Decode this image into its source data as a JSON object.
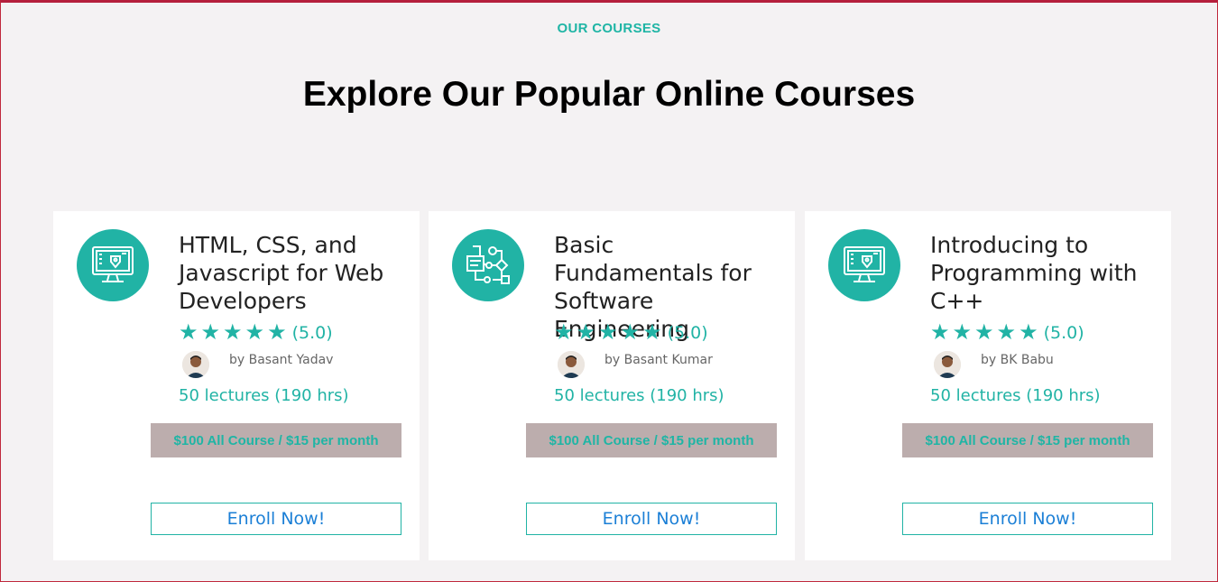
{
  "section": {
    "eyebrow": "OUR COURSES",
    "headline": "Explore Our Popular Online Courses"
  },
  "colors": {
    "accent": "#21b3a5",
    "link": "#1b7fd6",
    "price_bg": "#bcadad",
    "page_bg": "#f4f2f3",
    "frame_border": "#c0283c"
  },
  "courses": [
    {
      "icon": "monitor-design-icon",
      "title": "HTML, CSS, and Javascript for Web Developers",
      "stars": 5,
      "rating": "(5.0)",
      "author": "by Basant Yadav",
      "lectures": "50 lectures (190 hrs)",
      "price": "$100 All Course / $15 per month",
      "enroll_label": "Enroll Now!"
    },
    {
      "icon": "flowchart-icon",
      "title": "Basic Fundamentals for Software Engineering",
      "stars": 5,
      "rating": "(5.0)",
      "author": "by Basant Kumar",
      "lectures": "50 lectures (190 hrs)",
      "price": "$100 All Course / $15 per month",
      "enroll_label": "Enroll Now!"
    },
    {
      "icon": "monitor-design-icon",
      "title": "Introducing to Programming with C++",
      "stars": 5,
      "rating": "(5.0)",
      "author": "by BK Babu",
      "lectures": "50 lectures (190 hrs)",
      "price": "$100 All Course / $15 per month",
      "enroll_label": "Enroll Now!"
    }
  ]
}
